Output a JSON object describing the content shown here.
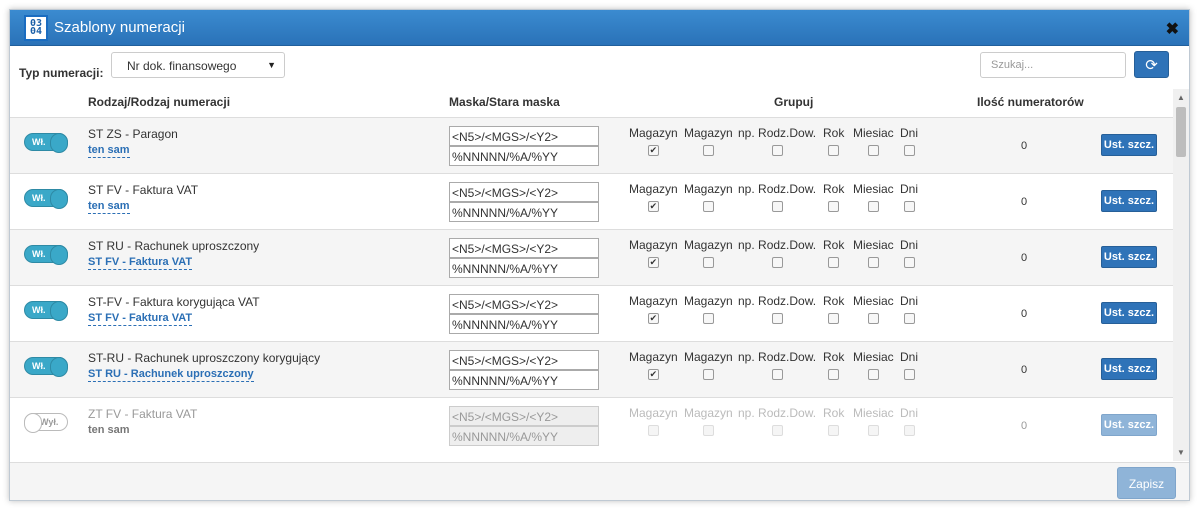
{
  "window": {
    "title": "Szablony numeracji",
    "icon": "numbering-template-icon",
    "icon_text": [
      "0",
      "3",
      "0",
      "4"
    ],
    "close_label": "✖"
  },
  "toolbar": {
    "type_label": "Typ numeracji:",
    "type_select_value": "Nr dok. finansowego",
    "search_placeholder": "Szukaj...",
    "refresh_icon": "refresh-icon"
  },
  "headers": {
    "kind": "Rodzaj/Rodzaj numeracji",
    "mask": "Maska/Stara maska",
    "group": "Grupuj",
    "count": "Ilość numeratorów"
  },
  "group_labels": [
    "Magazyn",
    "Magazyn",
    "np.",
    "Rodz.Dow.",
    "Rok",
    "Miesiac",
    "Dni"
  ],
  "rows": [
    {
      "toggle": "Wł.",
      "enabled": true,
      "name": "ST ZS - Paragon",
      "sub": "ten sam",
      "mask": "<N5>/<MGS>/<Y2>",
      "old_mask": "%NNNNN/%A/%YY",
      "checks": [
        true,
        false,
        false,
        false,
        false,
        false
      ],
      "count": "0",
      "button": "Ust. szcz."
    },
    {
      "toggle": "Wł.",
      "enabled": true,
      "name": "ST FV - Faktura VAT",
      "sub": "ten sam",
      "mask": "<N5>/<MGS>/<Y2>",
      "old_mask": "%NNNNN/%A/%YY",
      "checks": [
        true,
        false,
        false,
        false,
        false,
        false
      ],
      "count": "0",
      "button": "Ust. szcz."
    },
    {
      "toggle": "Wł.",
      "enabled": true,
      "name": "ST RU - Rachunek uproszczony",
      "sub": "ST FV - Faktura VAT",
      "mask": "<N5>/<MGS>/<Y2>",
      "old_mask": "%NNNNN/%A/%YY",
      "checks": [
        true,
        false,
        false,
        false,
        false,
        false
      ],
      "count": "0",
      "button": "Ust. szcz."
    },
    {
      "toggle": "Wł.",
      "enabled": true,
      "name": "ST-FV - Faktura korygująca VAT",
      "sub": "ST FV - Faktura VAT",
      "mask": "<N5>/<MGS>/<Y2>",
      "old_mask": "%NNNNN/%A/%YY",
      "checks": [
        true,
        false,
        false,
        false,
        false,
        false
      ],
      "count": "0",
      "button": "Ust. szcz."
    },
    {
      "toggle": "Wł.",
      "enabled": true,
      "name": "ST-RU - Rachunek uproszczony korygujący",
      "sub": "ST RU - Rachunek uproszczony",
      "mask": "<N5>/<MGS>/<Y2>",
      "old_mask": "%NNNNN/%A/%YY",
      "checks": [
        true,
        false,
        false,
        false,
        false,
        false
      ],
      "count": "0",
      "button": "Ust. szcz."
    },
    {
      "toggle": "Wył.",
      "enabled": false,
      "name": "ZT FV - Faktura VAT",
      "sub": "ten sam",
      "mask": "<N5>/<MGS>/<Y2>",
      "old_mask": "%NNNNN/%A/%YY",
      "checks": [
        false,
        false,
        false,
        false,
        false,
        false
      ],
      "count": "0",
      "button": "Ust. szcz."
    }
  ],
  "footer": {
    "save_label": "Zapisz"
  },
  "colors": {
    "title_bar": "#2a72b8",
    "primary_button": "#2f73b8",
    "toggle_on": "#3aa8c8",
    "link": "#2b6fb5"
  }
}
